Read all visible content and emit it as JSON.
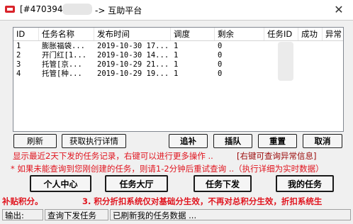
{
  "window": {
    "title_prefix": "[#470394",
    "title_suffix": "-> 互助平台",
    "close_glyph": "✕"
  },
  "table": {
    "columns": [
      "ID",
      "任务名称",
      "发布时间",
      "调度",
      "剩余",
      "任务ID",
      "成功",
      "异常"
    ],
    "rows": [
      {
        "id": "1",
        "name": "膨胀福袋...",
        "time": "2019-10-30 17...",
        "sched": "1",
        "remain": "0"
      },
      {
        "id": "2",
        "name": "开门红[1...",
        "time": "2019-10-30 14...",
        "sched": "1",
        "remain": "0"
      },
      {
        "id": "3",
        "name": "托管[京...",
        "time": "2019-10-29 21...",
        "sched": "1",
        "remain": "0"
      },
      {
        "id": "4",
        "name": "托管[种...",
        "time": "2019-10-29 19...",
        "sched": "1",
        "remain": "0"
      }
    ]
  },
  "buttons": {
    "refresh": "刷新",
    "get_details": "获取执行详情",
    "follow": "追补",
    "queue": "插队",
    "reset": "重置",
    "cancel": "取消",
    "personal": "个人中心",
    "hall": "任务大厅",
    "publish": "任务下发",
    "my_tasks": "我的任务"
  },
  "notes": {
    "line1": "显示最近2天下发的任务记录，右键可以进行更多操作 ..",
    "line1_right": "[右键可查询异常信息]",
    "line2": "* 如果未能查询到您刚创建的任务，则请1-2分钟后重试查询 ..（执行详细为实时数据）",
    "line3_left": "补贴积分。",
    "line3_right": "3. 积分折扣系统仅对基础分生效，不再对总积分生效，折扣系统生"
  },
  "status": {
    "label": "输出:",
    "query": "查询下发任务",
    "message": "已刷新我的任务数据 ..."
  }
}
